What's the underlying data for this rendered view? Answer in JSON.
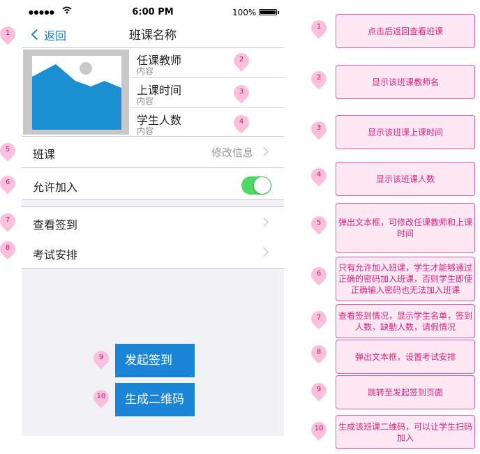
{
  "status_bar": {
    "signal": "●●●●●",
    "time": "6:00 PM",
    "battery_pct": "100%",
    "battery_level": 1.0
  },
  "nav": {
    "back_label": "返回",
    "title": "班课名称"
  },
  "course_info": [
    {
      "label": "任课教师",
      "value": "内容"
    },
    {
      "label": "上课时间",
      "value": "内容"
    },
    {
      "label": "学生人数",
      "value": "内容"
    }
  ],
  "settings": {
    "class_label": "班课",
    "class_detail": "修改信息",
    "allow_join_label": "允许加入",
    "allow_join_on": true,
    "attendance_label": "查看签到",
    "exam_label": "考试安排"
  },
  "buttons": {
    "start_signin": "发起签到",
    "qr_code": "生成二维码"
  },
  "markers": [
    "1",
    "2",
    "3",
    "4",
    "5",
    "6",
    "7",
    "8",
    "9",
    "10"
  ],
  "annotations": [
    {
      "num": "1",
      "text": "点击后返回查看班课"
    },
    {
      "num": "2",
      "text": "显示该班课教师名"
    },
    {
      "num": "3",
      "text": "显示该班课上课时间"
    },
    {
      "num": "4",
      "text": "显示该班课人数"
    },
    {
      "num": "5",
      "text": "弹出文本框，可修改任课教师和上课时间"
    },
    {
      "num": "6",
      "text": "只有允许加入班课，学生才能够通过正确的密码加入班课，否则学生即使正确输入密码也无法加入班课"
    },
    {
      "num": "7",
      "text": "查看签到情况，显示学生名单，签到人数，缺勤人数，请假情况"
    },
    {
      "num": "8",
      "text": "弹出文本框，设置考试安排"
    },
    {
      "num": "9",
      "text": "跳转至发起签到页面"
    },
    {
      "num": "10",
      "text": "生成该班课二维码，可以让学生扫码加入"
    }
  ],
  "colors": {
    "accent": "#1a7fd4",
    "button": "#1a85d6",
    "toggle_on": "#4cd964",
    "note_border": "#e35ba6",
    "note_text": "#e2247f",
    "pin": "#fcc0dc"
  },
  "icons": {
    "back": "chevron-left-icon",
    "disclosure": "chevron-right-icon",
    "image": "image-placeholder-icon",
    "wifi": "wifi-icon",
    "battery": "battery-icon"
  }
}
